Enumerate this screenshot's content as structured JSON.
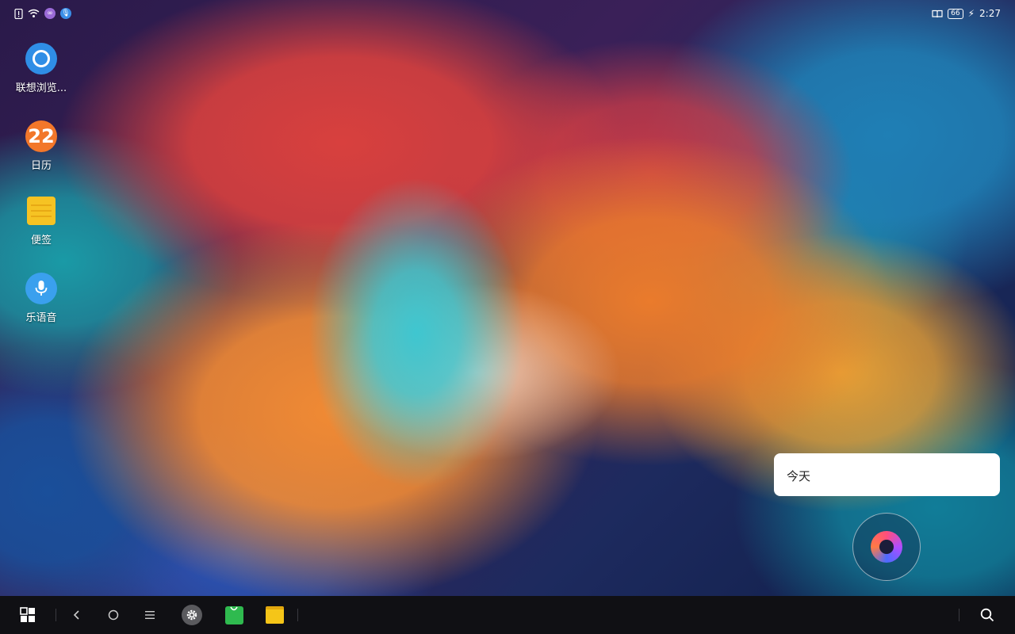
{
  "status_bar": {
    "left_icons": [
      "alert-icon",
      "wifi-icon",
      "link-icon",
      "mic-indicator-icon"
    ],
    "battery_level": "66",
    "time": "2:27"
  },
  "desktop": {
    "icons": [
      {
        "name": "browser",
        "label": "联想浏览...",
        "color": "#2f8ee6"
      },
      {
        "name": "calendar",
        "label": "日历",
        "day": "22",
        "color": "#f2772a"
      },
      {
        "name": "notes",
        "label": "便签",
        "color": "#f6c323"
      },
      {
        "name": "voice",
        "label": "乐语音",
        "color": "#3aa0ee"
      }
    ]
  },
  "today_card": {
    "label": "今天"
  },
  "taskbar": {
    "buttons": [
      "start-icon",
      "back-icon",
      "home-icon",
      "menu-icon",
      "settings-icon",
      "store-icon",
      "files-icon",
      "search-icon"
    ]
  }
}
